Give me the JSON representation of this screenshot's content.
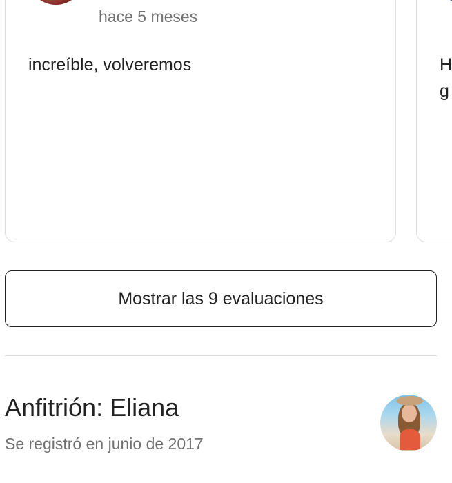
{
  "reviews": [
    {
      "date": "hace 5 meses",
      "text": "increíble, volveremos"
    },
    {
      "date": "",
      "text": "H g"
    }
  ],
  "show_all_button": {
    "label": "Mostrar las 9 evaluaciones"
  },
  "host": {
    "title": "Anfitrión: Eliana",
    "joined": "Se registró en junio de 2017",
    "avatar_icon": "host-avatar"
  },
  "colors": {
    "text_primary": "#222222",
    "text_secondary": "#717171",
    "border": "#dddddd"
  }
}
